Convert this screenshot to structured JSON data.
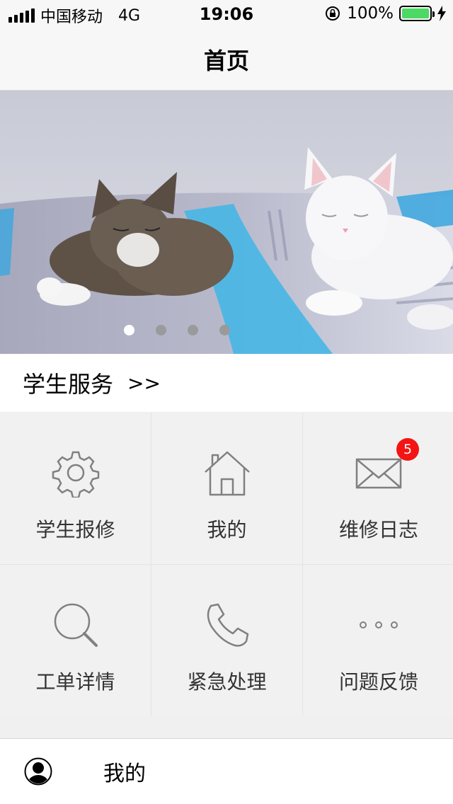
{
  "status_bar": {
    "carrier": "中国移动",
    "network": "4G",
    "time": "19:06",
    "battery": "100%"
  },
  "nav": {
    "title": "首页"
  },
  "banner": {
    "page_count": 4,
    "active_page": 1
  },
  "section": {
    "title": "学生服务",
    "arrow": ">>"
  },
  "grid": {
    "items": [
      {
        "label": "学生报修",
        "icon": "gear-icon"
      },
      {
        "label": "我的",
        "icon": "home-icon"
      },
      {
        "label": "维修日志",
        "icon": "mail-icon",
        "badge": "5"
      },
      {
        "label": "工单详情",
        "icon": "search-icon"
      },
      {
        "label": "紧急处理",
        "icon": "phone-icon"
      },
      {
        "label": "问题反馈",
        "icon": "more-icon"
      }
    ]
  },
  "bottom": {
    "label": "我的",
    "icon": "user-icon"
  },
  "colors": {
    "badge": "#f41414",
    "battery": "#4cd964",
    "icon_stroke": "#808080"
  }
}
